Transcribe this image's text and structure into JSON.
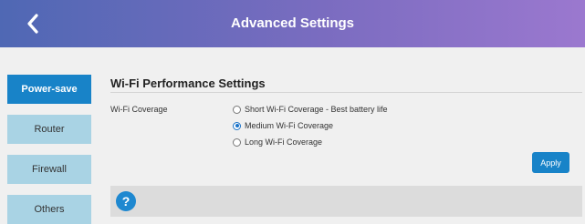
{
  "header": {
    "title": "Advanced Settings"
  },
  "sidebar": {
    "items": [
      {
        "label": "Power-save",
        "active": true
      },
      {
        "label": "Router",
        "active": false
      },
      {
        "label": "Firewall",
        "active": false
      },
      {
        "label": "Others",
        "active": false
      }
    ]
  },
  "main": {
    "section_title": "Wi-Fi Performance Settings",
    "field_label": "Wi-Fi Coverage",
    "options": [
      {
        "label": "Short Wi-Fi Coverage - Best battery life",
        "selected": false
      },
      {
        "label": "Medium Wi-Fi Coverage",
        "selected": true
      },
      {
        "label": "Long Wi-Fi Coverage",
        "selected": false
      }
    ],
    "apply_label": "Apply",
    "help_icon_glyph": "?"
  },
  "colors": {
    "header_gradient_start": "#4f68b4",
    "header_gradient_end": "#9b78cf",
    "active_tab": "#1883c8",
    "inactive_tab": "#a9d3e4",
    "apply_button": "#1883c8",
    "help_icon": "#1e88d0"
  },
  "icons": {
    "back": "chevron-left-icon",
    "help": "question-circle-icon"
  }
}
